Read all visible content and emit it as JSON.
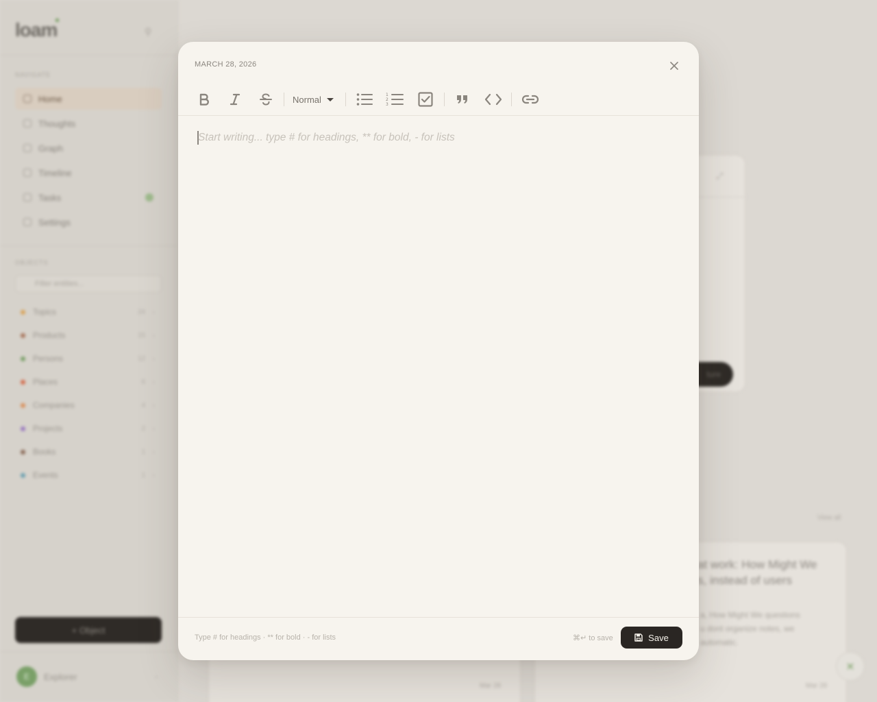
{
  "background": {
    "logo": "loam",
    "navigate_label": "NAVIGATE",
    "nav_items": [
      {
        "label": "Home"
      },
      {
        "label": "Thoughts"
      },
      {
        "label": "Graph"
      },
      {
        "label": "Timeline"
      },
      {
        "label": "Tasks"
      },
      {
        "label": "Settings"
      }
    ],
    "objects_label": "OBJECTS",
    "filter_placeholder": "Filter entities...",
    "objects": [
      {
        "label": "Topics",
        "count": "24",
        "color": "#d9a357"
      },
      {
        "label": "Products",
        "count": "15",
        "color": "#a8745a"
      },
      {
        "label": "Persons",
        "count": "12",
        "color": "#7aa068"
      },
      {
        "label": "Places",
        "count": "6",
        "color": "#d46a4a"
      },
      {
        "label": "Companies",
        "count": "4",
        "color": "#d9905a"
      },
      {
        "label": "Projects",
        "count": "2",
        "color": "#9a7ac0"
      },
      {
        "label": "Books",
        "count": "1",
        "color": "#8a6a58"
      },
      {
        "label": "Events",
        "count": "1",
        "color": "#6aa0b0"
      }
    ],
    "object_button": "+ Object",
    "user_initial": "E",
    "user_name": "Explorer",
    "view_all": "View all",
    "card_heading_line1": "at work: How Might We",
    "card_heading_line2": "s, instead of users",
    "card_body_line1": "a, How Might We questions",
    "card_body_line2": "u dont organize notes, we",
    "card_body_line3": "automatic.",
    "card_date_left": "Mar 28",
    "card_date_right": "Mar 28",
    "dark_button": "ture"
  },
  "modal": {
    "date": "MARCH 28, 2026",
    "toolbar": {
      "bold_icon": "bold-icon",
      "italic_icon": "italic-icon",
      "strike_icon": "strikethrough-icon",
      "style_select": "Normal",
      "bullet_icon": "bullet-list-icon",
      "ordered_icon": "ordered-list-icon",
      "task_icon": "checkbox-icon",
      "quote_icon": "quote-icon",
      "code_icon": "code-icon",
      "link_icon": "link-icon"
    },
    "editor_placeholder": "Start writing... type # for headings, ** for bold, - for lists",
    "footer_hint": "Type # for headings · ** for bold · - for lists",
    "save_hint": "⌘↵ to save",
    "save_label": "Save"
  },
  "colors": {
    "accent_dark": "#2a2623",
    "modal_bg": "#f7f4ee",
    "muted_text": "#8c8780",
    "brand_green": "#6e9a58"
  }
}
